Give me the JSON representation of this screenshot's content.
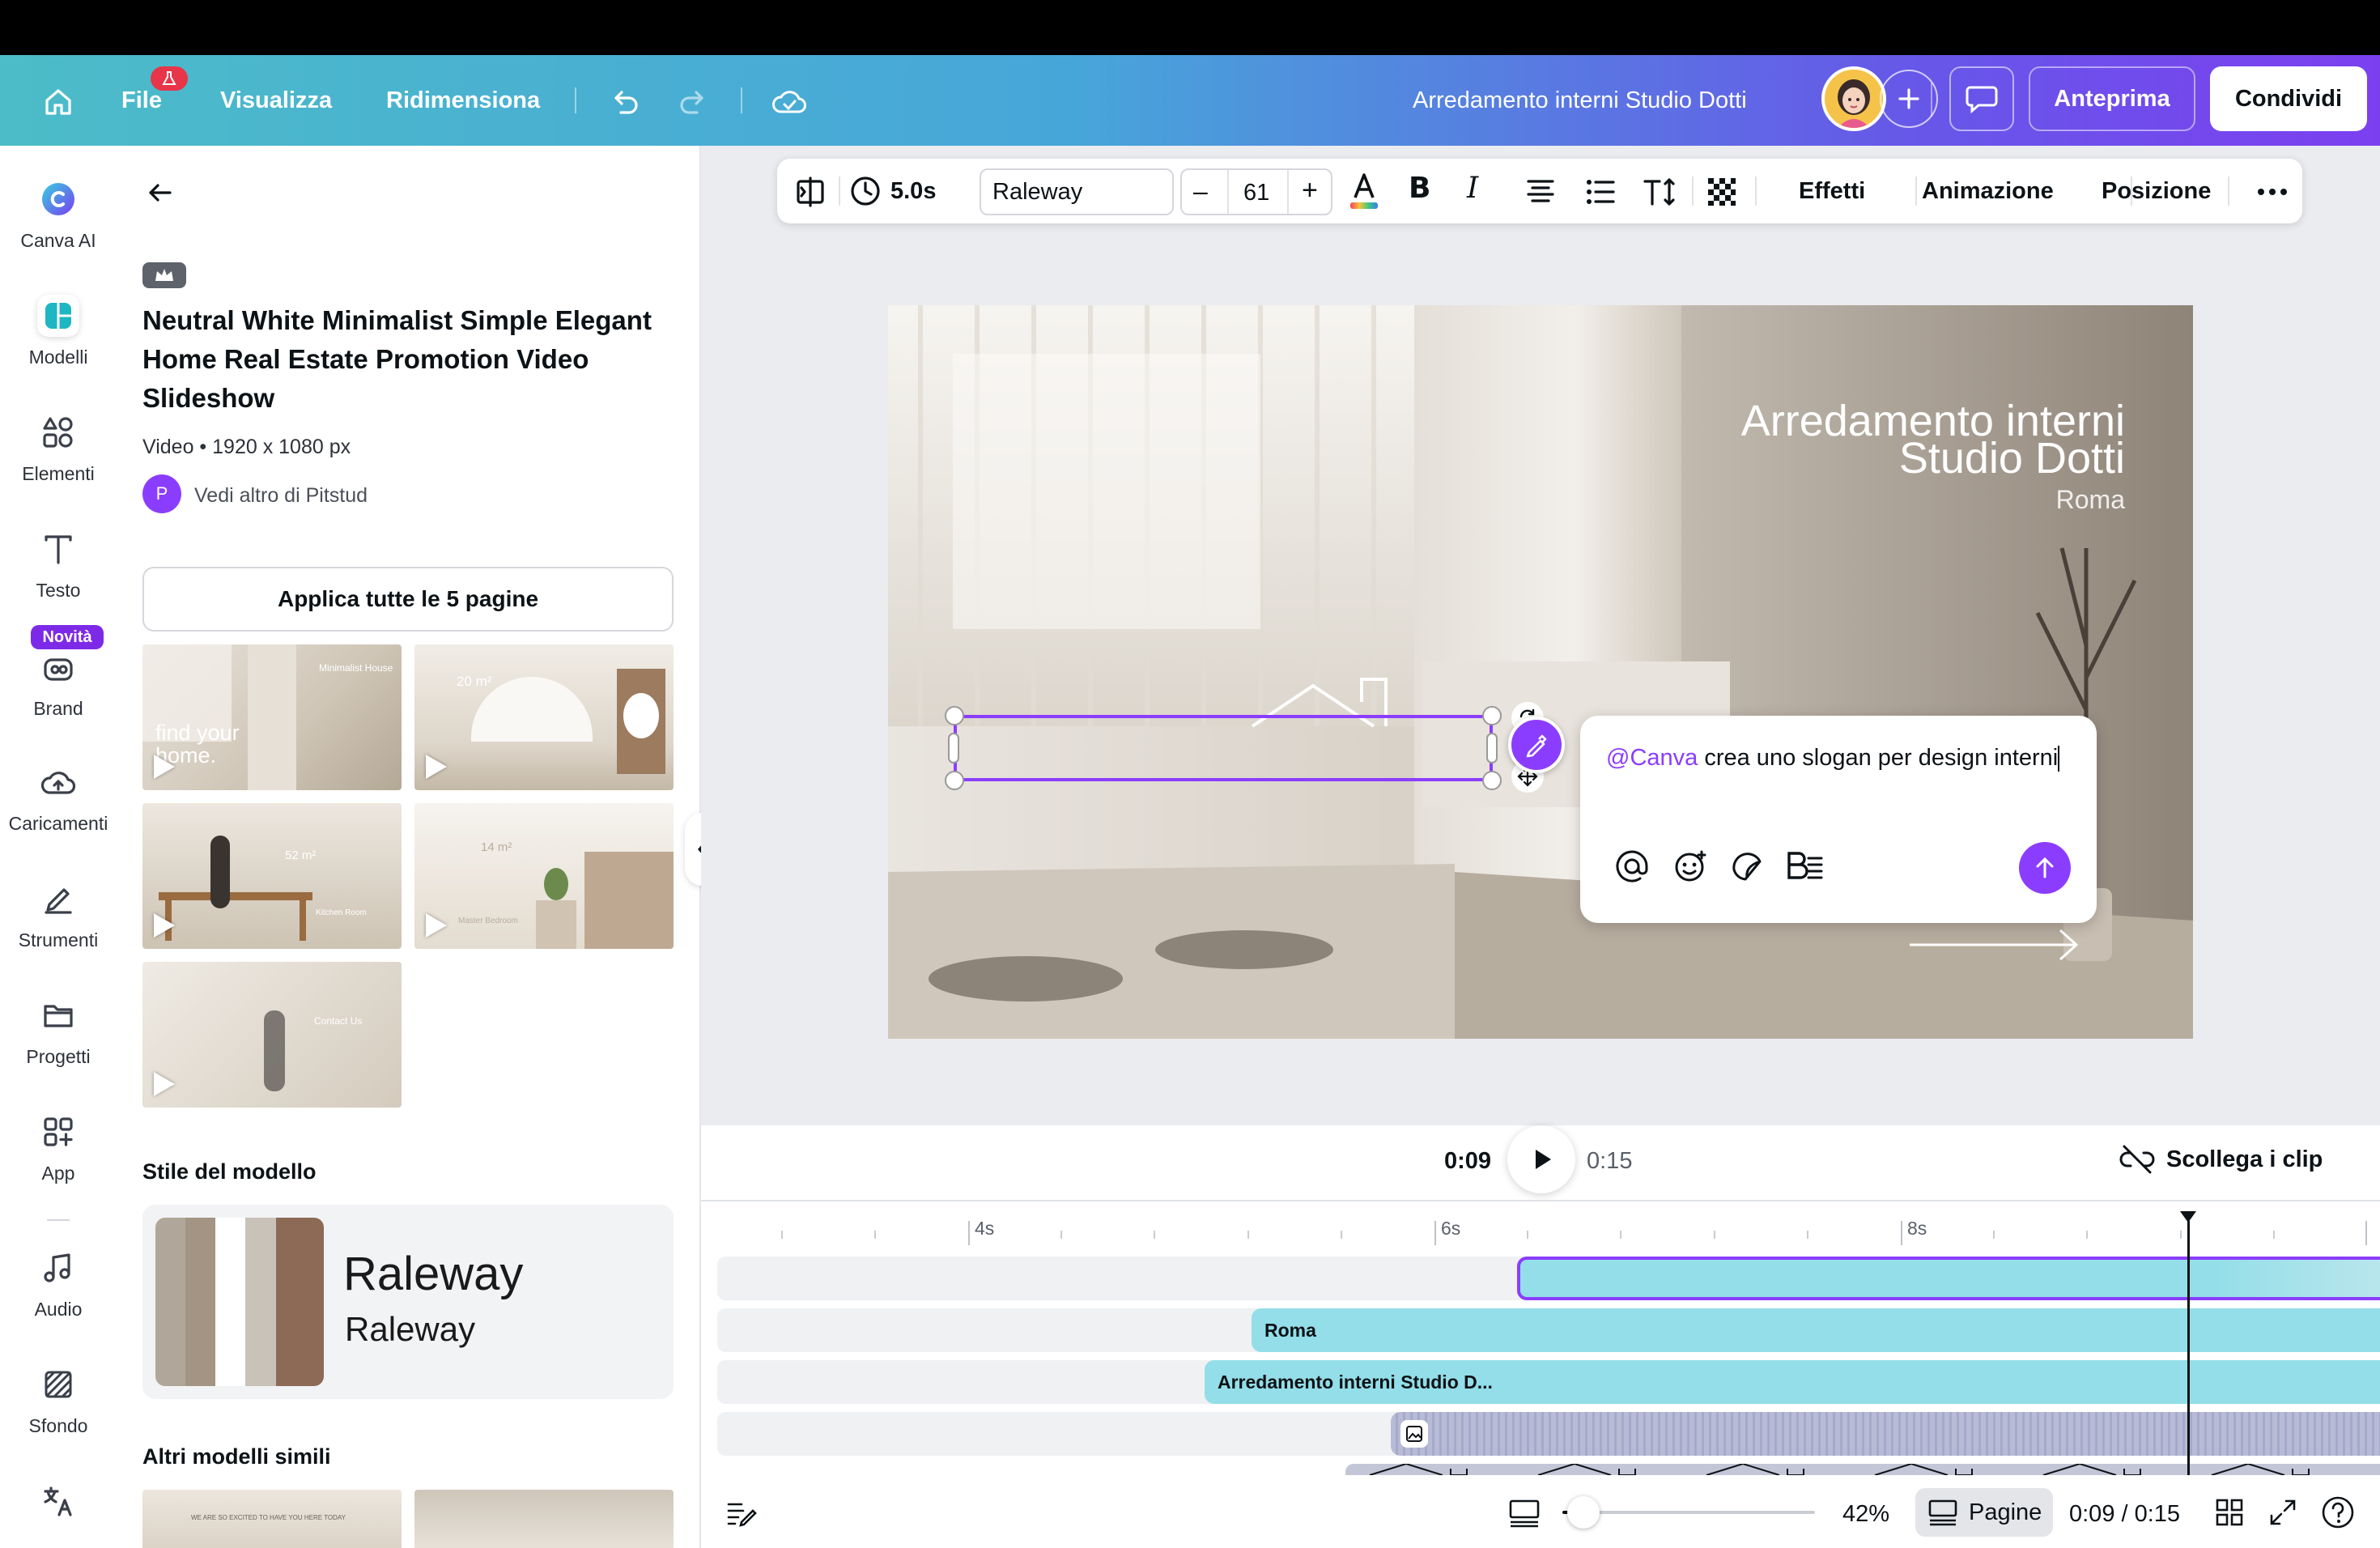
{
  "topbar": {
    "file": "File",
    "file_badge": "1",
    "visualizza": "Visualizza",
    "ridimensiona": "Ridimensiona",
    "doc_title": "Arredamento interni Studio Dotti",
    "anteprima": "Anteprima",
    "condividi": "Condividi"
  },
  "rail": [
    {
      "label": "Canva AI",
      "icon": "canva-ai-icon"
    },
    {
      "label": "Modelli",
      "icon": "templates-icon"
    },
    {
      "label": "Elementi",
      "icon": "elements-icon"
    },
    {
      "label": "Testo",
      "icon": "text-icon"
    },
    {
      "label": "Brand",
      "icon": "brand-icon",
      "badge": "Novità"
    },
    {
      "label": "Caricamenti",
      "icon": "upload-cloud-icon"
    },
    {
      "label": "Strumenti",
      "icon": "draw-icon"
    },
    {
      "label": "Progetti",
      "icon": "folder-icon"
    },
    {
      "label": "App",
      "icon": "apps-icon"
    },
    {
      "label": "Audio",
      "icon": "music-icon"
    },
    {
      "label": "Sfondo",
      "icon": "background-icon"
    }
  ],
  "panel": {
    "title": "Neutral White Minimalist Simple Elegant Home Real Estate Promotion Video Slideshow",
    "meta": "Video • 1920 x 1080 px",
    "author_initial": "P",
    "author": "Vedi altro di Pitstud",
    "apply_all": "Applica tutte le 5 pagine",
    "thumbs": [
      {
        "text1": "find your",
        "text2": "home.",
        "small": "Minimalist House"
      },
      {
        "text1": "20 m²",
        "text2": "",
        "small": ""
      },
      {
        "text1": "52 m²",
        "text2": "",
        "small": "Kitchen Room"
      },
      {
        "text1": "14 m²",
        "text2": "",
        "small": "Master Bedroom"
      },
      {
        "text1": "Contact Us",
        "text2": "",
        "small": ""
      }
    ],
    "style_heading": "Stile del modello",
    "style_font1": "Raleway",
    "style_font2": "Raleway",
    "palette": [
      "#b0a699",
      "#a39483",
      "#ffffff",
      "#c9c2b8",
      "#8c6a56"
    ],
    "similar_heading": "Altri modelli simili",
    "similar_small_text": "WE ARE SO EXCITED TO HAVE YOU HERE TODAY"
  },
  "toolbar": {
    "duration": "5.0s",
    "font": "Raleway",
    "size": "61",
    "effetti": "Effetti",
    "animazione": "Animazione",
    "posizione": "Posizione"
  },
  "slide": {
    "line1": "Arredamento interni",
    "line2": "Studio Dotti",
    "line3": "Roma"
  },
  "prompt": {
    "mention": "@Canva",
    "text": " crea uno slogan per design interni"
  },
  "playback": {
    "current": "0:09",
    "total": "0:15",
    "scollega": "Scollega i clip"
  },
  "ruler": [
    "4s",
    "6s",
    "8s"
  ],
  "clips": {
    "roma": "Roma",
    "titolo": "Arredamento interni Studio D..."
  },
  "bottom": {
    "zoom_percent": 42,
    "zoom": "42%",
    "pagine": "Pagine",
    "time": "0:09 / 0:15"
  },
  "colors": {
    "accent": "#8b3dff",
    "clip": "#93dee8",
    "gradient_start": "#4cbcc8",
    "gradient_end": "#7c3ff0"
  }
}
